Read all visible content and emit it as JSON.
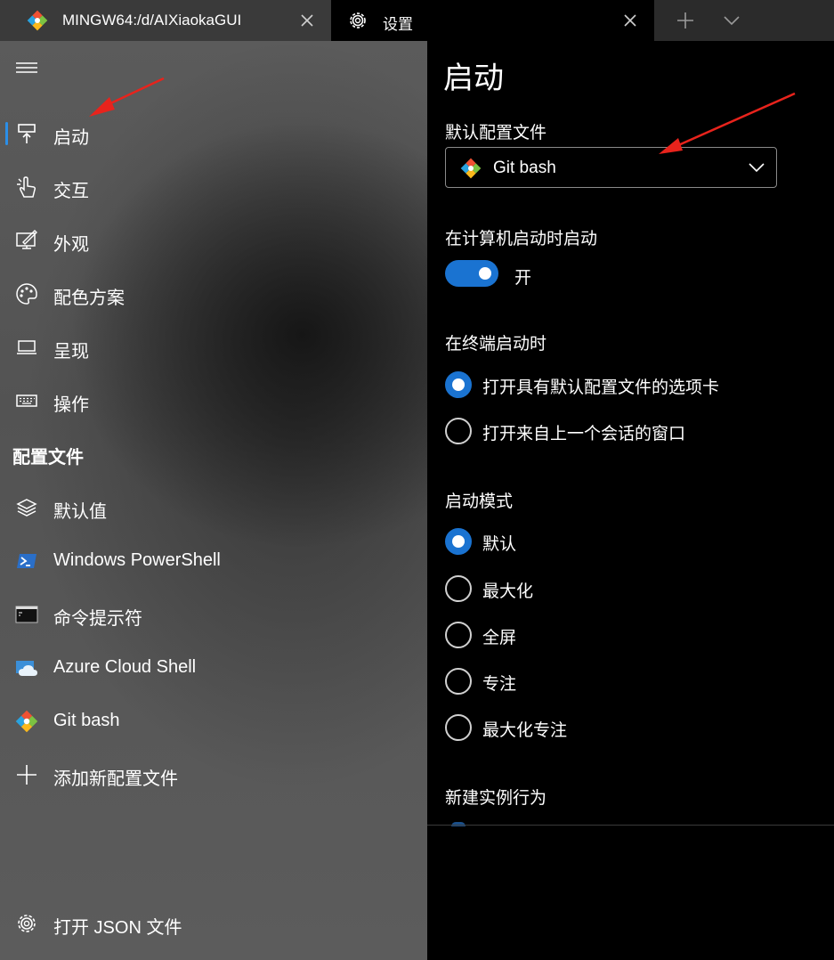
{
  "tabs": [
    {
      "title": "MINGW64:/d/AIXiaokaGUI",
      "icon": "git-bash-icon",
      "close_icon": "close-icon"
    },
    {
      "title": "设置",
      "icon": "gear-icon",
      "close_icon": "close-icon"
    }
  ],
  "tabbar": {
    "new_tab_icon": "plus-icon",
    "dropdown_icon": "chevron-down-icon"
  },
  "sidebar": {
    "menu_icon": "hamburger-icon",
    "items": [
      {
        "label": "启动",
        "icon": "startup-icon",
        "selected": true
      },
      {
        "label": "交互",
        "icon": "interaction-icon"
      },
      {
        "label": "外观",
        "icon": "appearance-icon"
      },
      {
        "label": "配色方案",
        "icon": "palette-icon"
      },
      {
        "label": "呈现",
        "icon": "rendering-icon"
      },
      {
        "label": "操作",
        "icon": "keyboard-icon"
      }
    ],
    "profiles_header": "配置文件",
    "profiles": [
      {
        "label": "默认值",
        "icon": "layers-icon"
      },
      {
        "label": "Windows PowerShell",
        "icon": "powershell-icon"
      },
      {
        "label": "命令提示符",
        "icon": "cmd-icon"
      },
      {
        "label": "Azure Cloud Shell",
        "icon": "azure-icon"
      },
      {
        "label": "Git bash",
        "icon": "git-bash-icon"
      },
      {
        "label": "添加新配置文件",
        "icon": "plus-icon"
      }
    ],
    "open_json": {
      "label": "打开 JSON 文件",
      "icon": "gear-icon"
    }
  },
  "content": {
    "title": "启动",
    "default_profile": {
      "label": "默认配置文件",
      "value": "Git bash",
      "icon": "git-bash-icon"
    },
    "launch_on_startup": {
      "label": "在计算机启动时启动",
      "state": "开",
      "on": true
    },
    "on_terminal_launch": {
      "label": "在终端启动时",
      "options": [
        "打开具有默认配置文件的选项卡",
        "打开来自上一个会话的窗口"
      ],
      "selected": 0
    },
    "launch_mode": {
      "label": "启动模式",
      "options": [
        "默认",
        "最大化",
        "全屏",
        "专注",
        "最大化专注"
      ],
      "selected": 0
    },
    "new_instance_behavior": {
      "label": "新建实例行为"
    }
  },
  "colors": {
    "accent": "#1a73d1",
    "annotation_arrow": "#e8231c"
  }
}
